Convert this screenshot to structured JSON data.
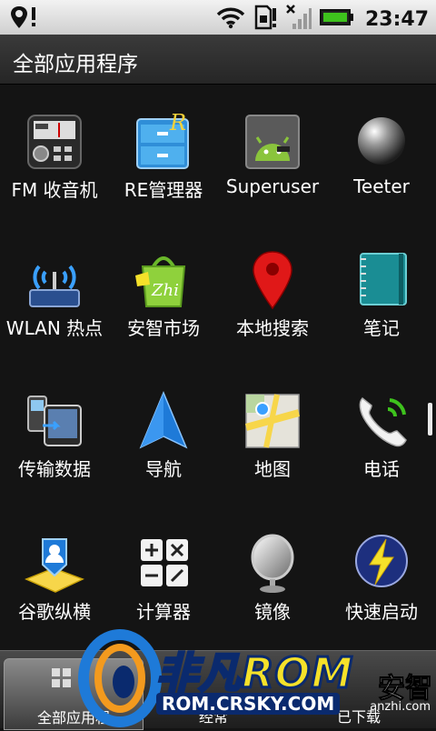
{
  "status_bar": {
    "time": "23:47",
    "icons": [
      "location-pin-icon",
      "wifi-icon",
      "sd-card-icon",
      "no-signal-icon",
      "battery-icon"
    ]
  },
  "title_bar": {
    "title": "全部应用程序"
  },
  "apps": [
    {
      "label": "FM 收音机",
      "icon": "fm-radio-icon"
    },
    {
      "label": "RE管理器",
      "icon": "re-manager-icon"
    },
    {
      "label": "Superuser",
      "icon": "superuser-icon"
    },
    {
      "label": "Teeter",
      "icon": "teeter-icon"
    },
    {
      "label": "WLAN 热点",
      "icon": "wlan-hotspot-icon"
    },
    {
      "label": "安智市场",
      "icon": "anzhi-market-icon"
    },
    {
      "label": "本地搜索",
      "icon": "local-search-icon"
    },
    {
      "label": "笔记",
      "icon": "notes-icon"
    },
    {
      "label": "传输数据",
      "icon": "transfer-data-icon"
    },
    {
      "label": "导航",
      "icon": "navigation-icon"
    },
    {
      "label": "地图",
      "icon": "maps-icon"
    },
    {
      "label": "电话",
      "icon": "phone-icon"
    },
    {
      "label": "谷歌纵横",
      "icon": "latitude-icon"
    },
    {
      "label": "计算器",
      "icon": "calculator-icon"
    },
    {
      "label": "镜像",
      "icon": "mirror-icon"
    },
    {
      "label": "快速启动",
      "icon": "quick-launch-icon"
    }
  ],
  "bottom_tabs": [
    {
      "label": "全部应用程",
      "active": true
    },
    {
      "label": "经常",
      "active": false
    },
    {
      "label": "已下载",
      "active": false
    }
  ],
  "watermark": {
    "brand_cn": "非凡",
    "brand_rom": "ROM",
    "url": "ROM.CRSKY.COM",
    "anzhi": "安智",
    "anzhi_url": "anzhi.com"
  },
  "colors": {
    "background": "#141414",
    "status_bar": "#dcdcdc",
    "title_bar": "#2e2e2e",
    "accent_blue": "#1e7ad8",
    "rom_yellow": "#f5e12a"
  }
}
